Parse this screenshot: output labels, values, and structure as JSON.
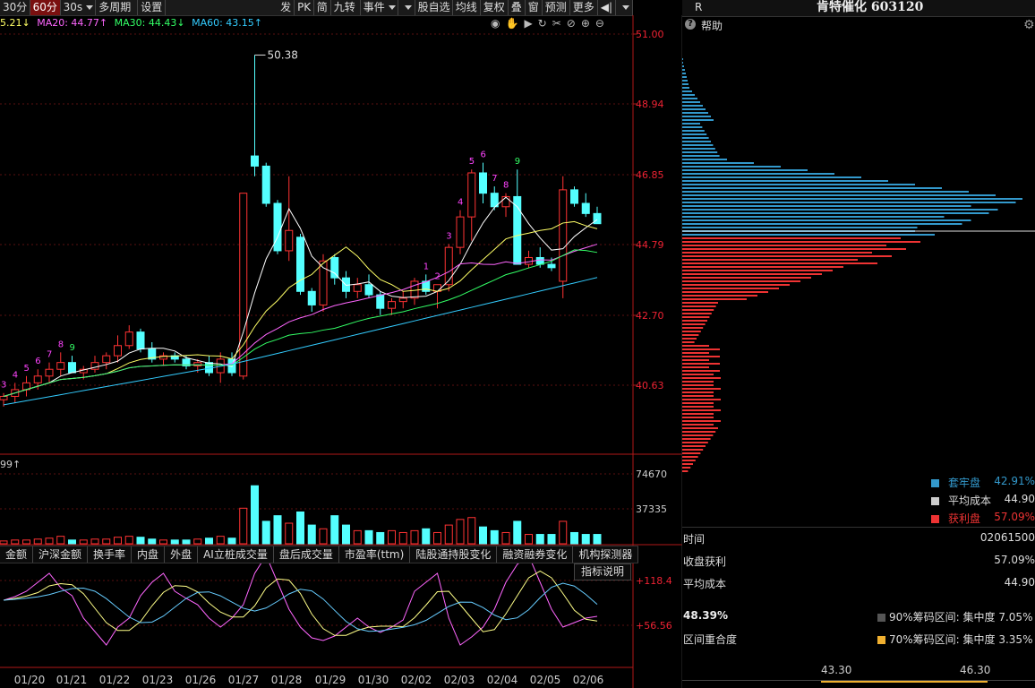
{
  "toolbar": {
    "items": [
      "30分",
      "60分",
      "30s",
      "多周期",
      "设置",
      "发",
      "PK",
      "简",
      "九转",
      "事件",
      "",
      "股自选",
      "均线",
      "复权",
      "叠",
      "窗",
      "预测",
      "更多"
    ],
    "active_index": 1
  },
  "ma_legend": {
    "ma5": "5.21↓",
    "ma20": "MA20: 44.77↑",
    "ma30": "MA30: 44.43↓",
    "ma60": "MA60: 43.15↑",
    "colors": {
      "ma5": "#ffffff",
      "ma20": "#ff66ff",
      "ma30": "#33ff66",
      "ma60": "#33ccff"
    }
  },
  "price_axis": [
    "51.00",
    "48.94",
    "46.85",
    "44.79",
    "42.70",
    "40.63"
  ],
  "max_annotation": "50.38",
  "volume": {
    "label": "99↑",
    "axis": [
      "74670",
      "37335"
    ]
  },
  "indicator_tabs": [
    "金额",
    "沪深金额",
    "换手率",
    "内盘",
    "外盘",
    "AI立桩成交量",
    "盘后成交量",
    "市盈率(ttm)",
    "陆股通持股变化",
    "融资融券变化",
    "机构探测器"
  ],
  "indicator_explain": "指标说明",
  "osc_axis": [
    "+118.4",
    "+56.56"
  ],
  "dates": [
    "01/20",
    "01/21",
    "01/22",
    "01/23",
    "01/26",
    "01/27",
    "01/28",
    "01/29",
    "01/30",
    "02/02",
    "02/03",
    "02/04",
    "02/05",
    "02/06"
  ],
  "nine_turn": {
    "left": [
      "3",
      "4",
      "5",
      "6",
      "7",
      "8",
      "9"
    ],
    "mid": [
      "1",
      "2",
      "3",
      "4",
      "5",
      "6",
      "7",
      "8",
      "9"
    ]
  },
  "right_panel": {
    "r_label": "R",
    "title": "肯特催化 603120",
    "help": "帮助",
    "legend": [
      {
        "label": "套牢盘",
        "value": "42.91%",
        "color": "#3399cc"
      },
      {
        "label": "平均成本",
        "value": "44.90",
        "color": "#cccccc"
      },
      {
        "label": "获利盘",
        "value": "57.09%",
        "color": "#ee3333"
      }
    ],
    "time_label": "时间",
    "time_value": "02061500",
    "profit_label": "收盘获利",
    "profit_value": "57.09%",
    "avg_label": "平均成本",
    "avg_value": "44.90",
    "overlap_pct": "48.39%",
    "overlap_label": "区间重合度",
    "band90": "90%筹码区间: 集中度 7.05%",
    "band70": "70%筹码区间: 集中度 3.35%",
    "band90_color": "#555555",
    "band70_color": "#f0b030",
    "range_low": "43.30",
    "range_high": "46.30"
  }
}
